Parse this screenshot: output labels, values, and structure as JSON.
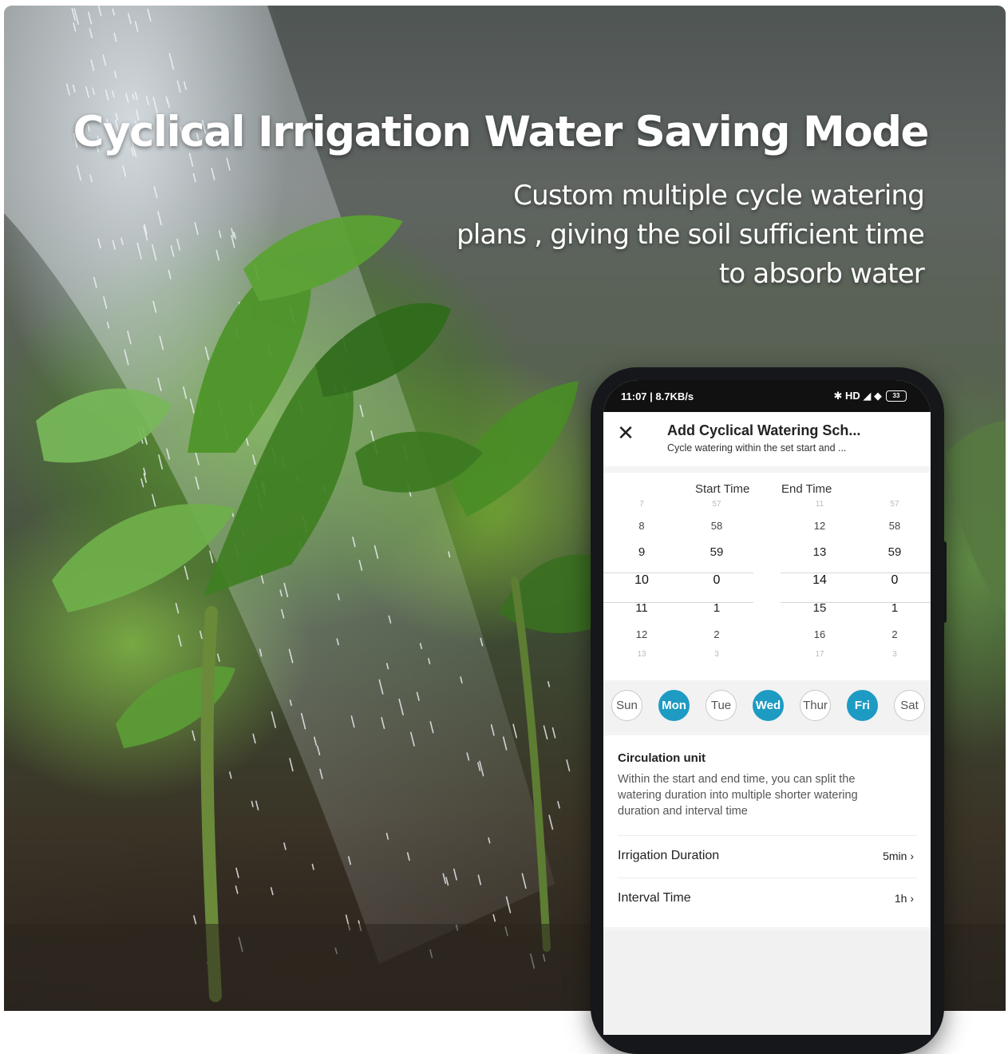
{
  "headline": "Cyclical Irrigation Water Saving Mode",
  "subline": [
    "Custom multiple cycle watering",
    "plans , giving the soil sufficient time",
    "to absorb water"
  ],
  "phone": {
    "status": {
      "time": "11:07 | 8.7KB/s",
      "icons": "✱ HD ◢ ◆",
      "battery": "33"
    },
    "header": {
      "title": "Add Cyclical Watering Sch...",
      "subtitle": "Cycle watering within the set start and ..."
    },
    "picker": {
      "start_label": "Start Time",
      "end_label": "End Time",
      "columns": [
        [
          "7",
          "8",
          "9",
          "10",
          "11",
          "12",
          "13"
        ],
        [
          "57",
          "58",
          "59",
          "0",
          "1",
          "2",
          "3"
        ],
        [
          "11",
          "12",
          "13",
          "14",
          "15",
          "16",
          "17"
        ],
        [
          "57",
          "58",
          "59",
          "0",
          "1",
          "2",
          "3"
        ]
      ],
      "selected": [
        "10",
        "0",
        "14",
        "0"
      ]
    },
    "days": [
      {
        "label": "Sun",
        "on": false
      },
      {
        "label": "Mon",
        "on": true
      },
      {
        "label": "Tue",
        "on": false
      },
      {
        "label": "Wed",
        "on": true
      },
      {
        "label": "Thur",
        "on": false
      },
      {
        "label": "Fri",
        "on": true
      },
      {
        "label": "Sat",
        "on": false
      }
    ],
    "circulation": {
      "title": "Circulation unit",
      "description": "Within the start and end time, you can split the watering duration into multiple shorter watering duration and interval time"
    },
    "irrigation_duration": {
      "label": "Irrigation Duration",
      "value": "5min"
    },
    "interval_time": {
      "label": "Interval Time",
      "value": "1h"
    },
    "chevron": "›"
  },
  "colors": {
    "accent": "#1e9bc3",
    "phone_body": "#15171a"
  }
}
